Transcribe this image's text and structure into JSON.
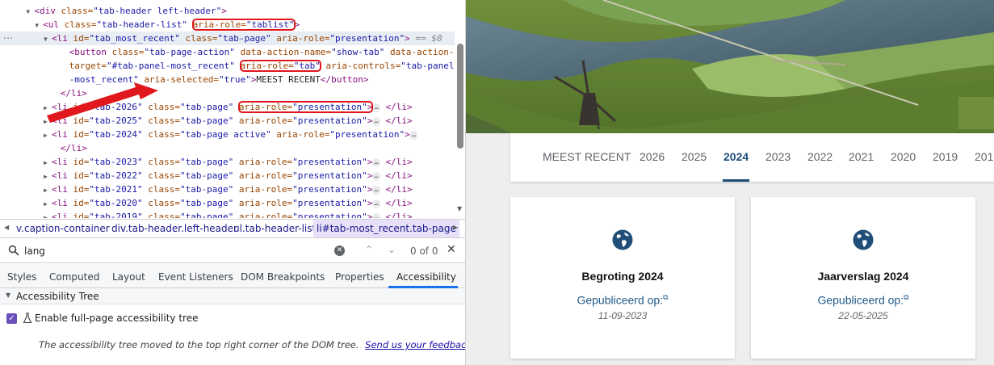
{
  "dom_tree": {
    "lines": [
      {
        "indent": 3,
        "tri": "open",
        "segments": [
          [
            "tag",
            "<div "
          ],
          [
            "attr",
            "class="
          ],
          [
            "val",
            "\"tab-header left-header\""
          ],
          [
            "tag",
            ">"
          ]
        ]
      },
      {
        "indent": 4,
        "tri": "open",
        "segments": [
          [
            "tag",
            "<ul "
          ],
          [
            "attr",
            "class="
          ],
          [
            "val",
            "\"tab-header-list\" "
          ],
          [
            "box-start",
            ""
          ],
          [
            "attr",
            "aria-role="
          ],
          [
            "val",
            "\"tablist\""
          ],
          [
            "box-end",
            ""
          ],
          [
            "tag",
            ">"
          ]
        ]
      },
      {
        "indent": 5,
        "tri": "open",
        "selected": true,
        "segments": [
          [
            "tag",
            "<li "
          ],
          [
            "attr",
            "id="
          ],
          [
            "val",
            "\"tab_most_recent\" "
          ],
          [
            "attr",
            "class="
          ],
          [
            "val",
            "\"tab-page\" "
          ],
          [
            "attr",
            "aria-role="
          ],
          [
            "val",
            "\"presentation\""
          ],
          [
            "tag",
            "> "
          ],
          [
            "dollar",
            "== $0"
          ]
        ]
      },
      {
        "indent": 7,
        "tri": "",
        "segments": [
          [
            "tag",
            "<button "
          ],
          [
            "attr",
            "class="
          ],
          [
            "val",
            "\"tab-page-action\" "
          ],
          [
            "attr",
            "data-action-name="
          ],
          [
            "val",
            "\"show-tab\" "
          ],
          [
            "attr",
            "data-action-"
          ]
        ]
      },
      {
        "indent": 7,
        "tri": "",
        "segments": [
          [
            "attr",
            "target="
          ],
          [
            "val",
            "\"#tab-panel-most_recent\" "
          ],
          [
            "box-start",
            ""
          ],
          [
            "attr",
            "aria-role="
          ],
          [
            "val",
            "\"tab\""
          ],
          [
            "box-end",
            ""
          ],
          [
            "attr",
            " aria-controls="
          ],
          [
            "val",
            "\"tab-panel"
          ]
        ]
      },
      {
        "indent": 7,
        "tri": "",
        "segments": [
          [
            "val",
            "-most_recent\" "
          ],
          [
            "attr",
            "aria-selected="
          ],
          [
            "val",
            "\"true\""
          ],
          [
            "tag",
            ">"
          ],
          [
            "txt",
            "MEEST RECENT"
          ],
          [
            "tag",
            "</button>"
          ]
        ]
      },
      {
        "indent": 6,
        "tri": "",
        "segments": [
          [
            "tag",
            "</li>"
          ]
        ]
      },
      {
        "indent": 5,
        "tri": "closed",
        "segments": [
          [
            "tag",
            "<li "
          ],
          [
            "attr",
            "id="
          ],
          [
            "val",
            "\"tab-2026\" "
          ],
          [
            "attr",
            "class="
          ],
          [
            "val",
            "\"tab-page\" "
          ],
          [
            "box-start",
            ""
          ],
          [
            "attr",
            "aria-role="
          ],
          [
            "val",
            "\"presentation\""
          ],
          [
            "tag",
            ">"
          ],
          [
            "box-end",
            ""
          ],
          [
            "ell",
            "…"
          ],
          [
            "tag",
            " </li>"
          ]
        ]
      },
      {
        "indent": 5,
        "tri": "closed",
        "segments": [
          [
            "tag",
            "<li "
          ],
          [
            "attr",
            "id="
          ],
          [
            "val",
            "\"tab-2025\" "
          ],
          [
            "attr",
            "class="
          ],
          [
            "val",
            "\"tab-page\" "
          ],
          [
            "attr",
            "aria-role="
          ],
          [
            "val",
            "\"presentation\""
          ],
          [
            "tag",
            ">"
          ],
          [
            "ell",
            "…"
          ],
          [
            "tag",
            " </li>"
          ]
        ]
      },
      {
        "indent": 5,
        "tri": "closed",
        "segments": [
          [
            "tag",
            "<li "
          ],
          [
            "attr",
            "id="
          ],
          [
            "val",
            "\"tab-2024\" "
          ],
          [
            "attr",
            "class="
          ],
          [
            "val",
            "\"tab-page active\" "
          ],
          [
            "attr",
            "aria-role="
          ],
          [
            "val",
            "\"presentation\""
          ],
          [
            "tag",
            ">"
          ],
          [
            "ell",
            "…"
          ]
        ]
      },
      {
        "indent": 6,
        "tri": "",
        "segments": [
          [
            "tag",
            "</li>"
          ]
        ]
      },
      {
        "indent": 5,
        "tri": "closed",
        "segments": [
          [
            "tag",
            "<li "
          ],
          [
            "attr",
            "id="
          ],
          [
            "val",
            "\"tab-2023\" "
          ],
          [
            "attr",
            "class="
          ],
          [
            "val",
            "\"tab-page\" "
          ],
          [
            "attr",
            "aria-role="
          ],
          [
            "val",
            "\"presentation\""
          ],
          [
            "tag",
            ">"
          ],
          [
            "ell",
            "…"
          ],
          [
            "tag",
            " </li>"
          ]
        ]
      },
      {
        "indent": 5,
        "tri": "closed",
        "segments": [
          [
            "tag",
            "<li "
          ],
          [
            "attr",
            "id="
          ],
          [
            "val",
            "\"tab-2022\" "
          ],
          [
            "attr",
            "class="
          ],
          [
            "val",
            "\"tab-page\" "
          ],
          [
            "attr",
            "aria-role="
          ],
          [
            "val",
            "\"presentation\""
          ],
          [
            "tag",
            ">"
          ],
          [
            "ell",
            "…"
          ],
          [
            "tag",
            " </li>"
          ]
        ]
      },
      {
        "indent": 5,
        "tri": "closed",
        "segments": [
          [
            "tag",
            "<li "
          ],
          [
            "attr",
            "id="
          ],
          [
            "val",
            "\"tab-2021\" "
          ],
          [
            "attr",
            "class="
          ],
          [
            "val",
            "\"tab-page\" "
          ],
          [
            "attr",
            "aria-role="
          ],
          [
            "val",
            "\"presentation\""
          ],
          [
            "tag",
            ">"
          ],
          [
            "ell",
            "…"
          ],
          [
            "tag",
            " </li>"
          ]
        ]
      },
      {
        "indent": 5,
        "tri": "closed",
        "segments": [
          [
            "tag",
            "<li "
          ],
          [
            "attr",
            "id="
          ],
          [
            "val",
            "\"tab-2020\" "
          ],
          [
            "attr",
            "class="
          ],
          [
            "val",
            "\"tab-page\" "
          ],
          [
            "attr",
            "aria-role="
          ],
          [
            "val",
            "\"presentation\""
          ],
          [
            "tag",
            ">"
          ],
          [
            "ell",
            "…"
          ],
          [
            "tag",
            " </li>"
          ]
        ]
      },
      {
        "indent": 5,
        "tri": "closed",
        "segments": [
          [
            "tag",
            "<li "
          ],
          [
            "attr",
            "id="
          ],
          [
            "val",
            "\"tab-2019\" "
          ],
          [
            "attr",
            "class="
          ],
          [
            "val",
            "\"tab-page\" "
          ],
          [
            "attr",
            "aria-role="
          ],
          [
            "val",
            "\"presentation\""
          ],
          [
            "tag",
            ">"
          ],
          [
            "ell",
            "…"
          ],
          [
            "tag",
            " </li>"
          ]
        ]
      }
    ]
  },
  "breadcrumbs": [
    "v.caption-container",
    "div.tab-header.left-header",
    "ul.tab-header-list",
    "li#tab-most_recent.tab-page"
  ],
  "search": {
    "value": "lang",
    "match_count": "0 of 0"
  },
  "panel_tabs": [
    "Styles",
    "Computed",
    "Layout",
    "Event Listeners",
    "DOM Breakpoints",
    "Properties",
    "Accessibility"
  ],
  "accessibility": {
    "header": "Accessibility Tree",
    "option_label": "Enable full-page accessibility tree",
    "note": "The accessibility tree moved to the top right corner of the DOM tree.",
    "feedback_link": "Send us your feedback."
  },
  "page": {
    "tabs": [
      "MEEST RECENT",
      "2026",
      "2025",
      "2024",
      "2023",
      "2022",
      "2021",
      "2020",
      "2019",
      "201"
    ],
    "active_tab": "2024",
    "cards": [
      {
        "title": "Begroting 2024",
        "link": "Gepubliceerd op:",
        "date": "11-09-2023"
      },
      {
        "title": "Jaarverslag 2024",
        "link": "Gepubliceerd op:",
        "date": "22-05-2025"
      }
    ]
  },
  "colors": {
    "annotation": "#e0171d",
    "active_tab": "#1f4e79",
    "accent": "#1a73e8"
  }
}
